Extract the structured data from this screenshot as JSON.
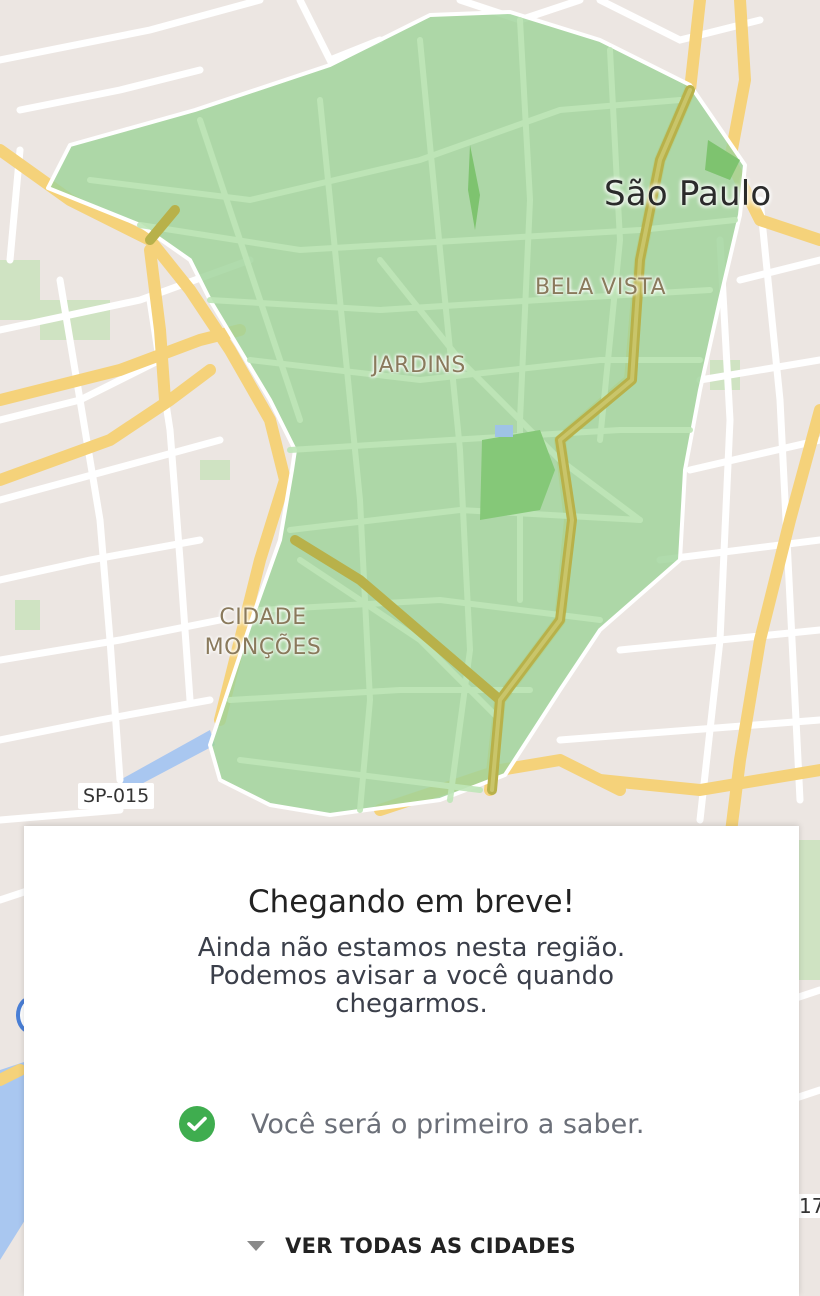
{
  "map": {
    "city_label": "São Paulo",
    "neighborhoods": {
      "bela_vista": "BELA VISTA",
      "jardins": "JARDINS",
      "cidade_moncoes_line1": "CIDADE",
      "cidade_moncoes_line2": "MONÇÕES"
    },
    "road_shield": "SP-015",
    "edge_number": "17",
    "coverage_color": "#9fd39a",
    "road_color": "#f7d88a",
    "land_color": "#ece6e2"
  },
  "card": {
    "title": "Chegando em breve!",
    "message": "Ainda não estamos nesta região. Podemos avisar a você quando chegarmos.",
    "confirmation": "Você será o primeiro a saber.",
    "see_all_label": "VER TODAS AS CIDADES",
    "check_color": "#3fad4f"
  }
}
